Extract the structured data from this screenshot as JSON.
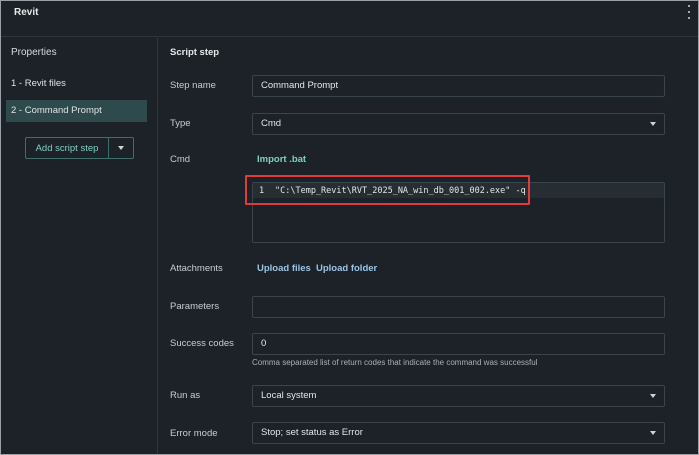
{
  "window": {
    "title": "Revit"
  },
  "sidebar": {
    "heading": "Properties",
    "items": [
      {
        "label": "1 - Revit files"
      },
      {
        "label": "2 - Command Prompt"
      }
    ],
    "add_button": "Add script step"
  },
  "form": {
    "section_title": "Script step",
    "step_name": {
      "label": "Step name",
      "value": "Command Prompt"
    },
    "type": {
      "label": "Type",
      "value": "Cmd"
    },
    "cmd": {
      "label": "Cmd",
      "import_link": "Import .bat",
      "line_number": "1",
      "code": "\"C:\\Temp_Revit\\RVT_2025_NA_win_db_001_002.exe\" -q"
    },
    "attachments": {
      "label": "Attachments",
      "upload_files": "Upload files",
      "upload_folder": "Upload folder"
    },
    "parameters": {
      "label": "Parameters",
      "value": ""
    },
    "success_codes": {
      "label": "Success codes",
      "value": "0",
      "hint": "Comma separated list of return codes that indicate the command was successful"
    },
    "run_as": {
      "label": "Run as",
      "value": "Local system"
    },
    "error_mode": {
      "label": "Error mode",
      "value": "Stop; set status as Error"
    }
  },
  "colors": {
    "accent": "#7fd0c4",
    "highlight": "#e0393e",
    "background": "#1c2227"
  }
}
